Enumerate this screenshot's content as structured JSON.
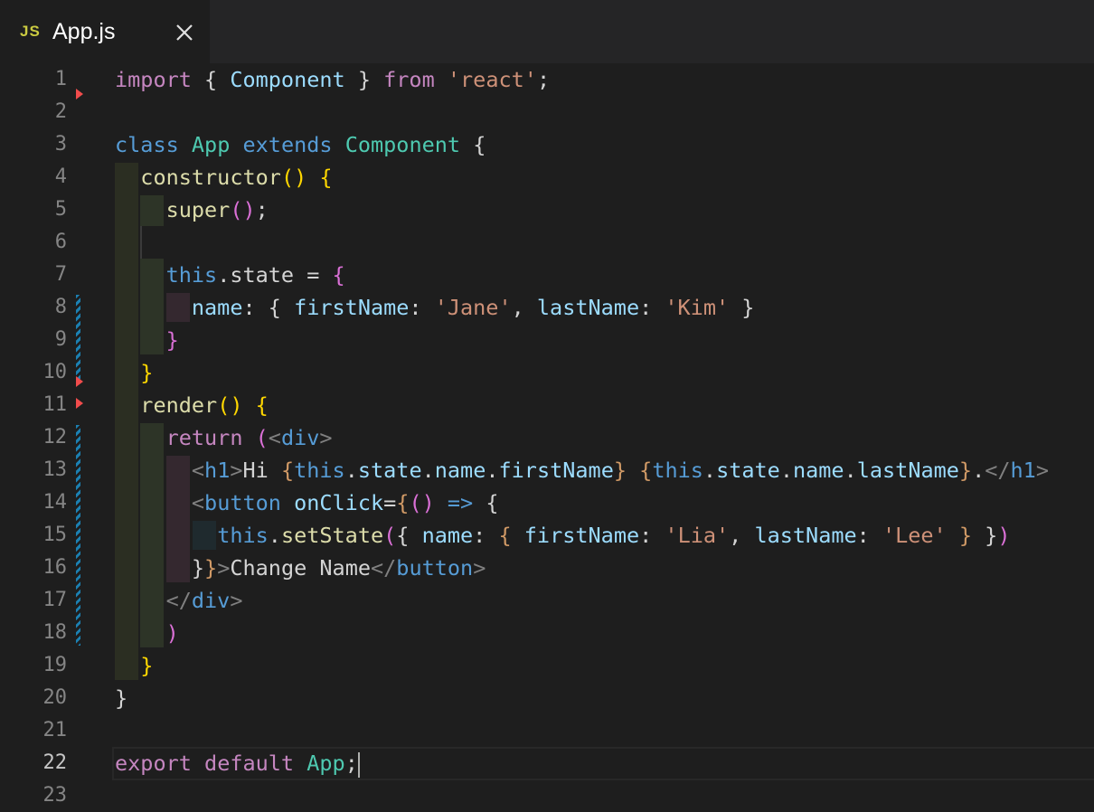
{
  "tab": {
    "icon_label": "JS",
    "title": "App.js",
    "close_icon": "close-icon"
  },
  "line_numbers": [
    "1",
    "2",
    "3",
    "4",
    "5",
    "6",
    "7",
    "8",
    "9",
    "10",
    "11",
    "12",
    "13",
    "14",
    "15",
    "16",
    "17",
    "18",
    "19",
    "20",
    "21",
    "22",
    "23"
  ],
  "active_line": "22",
  "code_lines": [
    [
      [
        "k",
        "import"
      ],
      [
        "p",
        " { "
      ],
      [
        "v",
        "Component"
      ],
      [
        "p",
        " } "
      ],
      [
        "k",
        "from"
      ],
      [
        "p",
        " "
      ],
      [
        "s",
        "'react'"
      ],
      [
        "p",
        ";"
      ]
    ],
    [],
    [
      [
        "b",
        "class"
      ],
      [
        "p",
        " "
      ],
      [
        "t",
        "App"
      ],
      [
        "p",
        " "
      ],
      [
        "b",
        "extends"
      ],
      [
        "p",
        " "
      ],
      [
        "t",
        "Component"
      ],
      [
        "p",
        " {"
      ]
    ],
    [
      [
        "p",
        "  "
      ],
      [
        "f",
        "constructor"
      ],
      [
        "y",
        "()"
      ],
      [
        "p",
        " "
      ],
      [
        "y",
        "{"
      ]
    ],
    [
      [
        "p",
        "    "
      ],
      [
        "f",
        "super"
      ],
      [
        "m",
        "()"
      ],
      [
        "p",
        ";"
      ]
    ],
    [],
    [
      [
        "p",
        "    "
      ],
      [
        "b",
        "this"
      ],
      [
        "p",
        ".state = "
      ],
      [
        "m",
        "{"
      ]
    ],
    [
      [
        "p",
        "      "
      ],
      [
        "v",
        "name"
      ],
      [
        "p",
        ": { "
      ],
      [
        "v",
        "firstName"
      ],
      [
        "p",
        ": "
      ],
      [
        "s",
        "'Jane'"
      ],
      [
        "p",
        ", "
      ],
      [
        "v",
        "lastName"
      ],
      [
        "p",
        ": "
      ],
      [
        "s",
        "'Kim'"
      ],
      [
        "p",
        " }"
      ]
    ],
    [
      [
        "p",
        "    "
      ],
      [
        "m",
        "}"
      ]
    ],
    [
      [
        "p",
        "  "
      ],
      [
        "y",
        "}"
      ]
    ],
    [
      [
        "p",
        "  "
      ],
      [
        "f",
        "render"
      ],
      [
        "y",
        "()"
      ],
      [
        "p",
        " "
      ],
      [
        "y",
        "{"
      ]
    ],
    [
      [
        "p",
        "    "
      ],
      [
        "k",
        "return"
      ],
      [
        "p",
        " "
      ],
      [
        "m",
        "("
      ],
      [
        "g",
        "<"
      ],
      [
        "b",
        "div"
      ],
      [
        "g",
        ">"
      ]
    ],
    [
      [
        "p",
        "      "
      ],
      [
        "g",
        "<"
      ],
      [
        "b",
        "h1"
      ],
      [
        "g",
        ">"
      ],
      [
        "p",
        "Hi "
      ],
      [
        "o",
        "{"
      ],
      [
        "b",
        "this"
      ],
      [
        "p",
        "."
      ],
      [
        "v",
        "state"
      ],
      [
        "p",
        "."
      ],
      [
        "v",
        "name"
      ],
      [
        "p",
        "."
      ],
      [
        "v",
        "firstName"
      ],
      [
        "o",
        "}"
      ],
      [
        "p",
        " "
      ],
      [
        "o",
        "{"
      ],
      [
        "b",
        "this"
      ],
      [
        "p",
        "."
      ],
      [
        "v",
        "state"
      ],
      [
        "p",
        "."
      ],
      [
        "v",
        "name"
      ],
      [
        "p",
        "."
      ],
      [
        "v",
        "lastName"
      ],
      [
        "o",
        "}"
      ],
      [
        "p",
        "."
      ],
      [
        "g",
        "</"
      ],
      [
        "b",
        "h1"
      ],
      [
        "g",
        ">"
      ]
    ],
    [
      [
        "p",
        "      "
      ],
      [
        "g",
        "<"
      ],
      [
        "b",
        "button"
      ],
      [
        "p",
        " "
      ],
      [
        "v",
        "onClick"
      ],
      [
        "p",
        "="
      ],
      [
        "o",
        "{"
      ],
      [
        "m",
        "()"
      ],
      [
        "p",
        " "
      ],
      [
        "b",
        "=>"
      ],
      [
        "p",
        " {"
      ]
    ],
    [
      [
        "p",
        "        "
      ],
      [
        "b",
        "this"
      ],
      [
        "p",
        "."
      ],
      [
        "f",
        "setState"
      ],
      [
        "m",
        "("
      ],
      [
        "p",
        "{ "
      ],
      [
        "v",
        "name"
      ],
      [
        "p",
        ": "
      ],
      [
        "o",
        "{"
      ],
      [
        "p",
        " "
      ],
      [
        "v",
        "firstName"
      ],
      [
        "p",
        ": "
      ],
      [
        "s",
        "'Lia'"
      ],
      [
        "p",
        ", "
      ],
      [
        "v",
        "lastName"
      ],
      [
        "p",
        ": "
      ],
      [
        "s",
        "'Lee'"
      ],
      [
        "p",
        " "
      ],
      [
        "o",
        "}"
      ],
      [
        "p",
        " }"
      ],
      [
        "m",
        ")"
      ]
    ],
    [
      [
        "p",
        "      }"
      ],
      [
        "o",
        "}"
      ],
      [
        "g",
        ">"
      ],
      [
        "p",
        "Change Name"
      ],
      [
        "g",
        "</"
      ],
      [
        "b",
        "button"
      ],
      [
        "g",
        ">"
      ]
    ],
    [
      [
        "p",
        "    "
      ],
      [
        "g",
        "</"
      ],
      [
        "b",
        "div"
      ],
      [
        "g",
        ">"
      ]
    ],
    [
      [
        "p",
        "    "
      ],
      [
        "m",
        ")"
      ]
    ],
    [
      [
        "p",
        "  "
      ],
      [
        "y",
        "}"
      ]
    ],
    [
      [
        "p",
        "}"
      ]
    ],
    [],
    [
      [
        "k",
        "export"
      ],
      [
        "p",
        " "
      ],
      [
        "k",
        "default"
      ],
      [
        "p",
        " "
      ],
      [
        "t",
        "App"
      ],
      [
        "p",
        ";"
      ]
    ],
    []
  ]
}
